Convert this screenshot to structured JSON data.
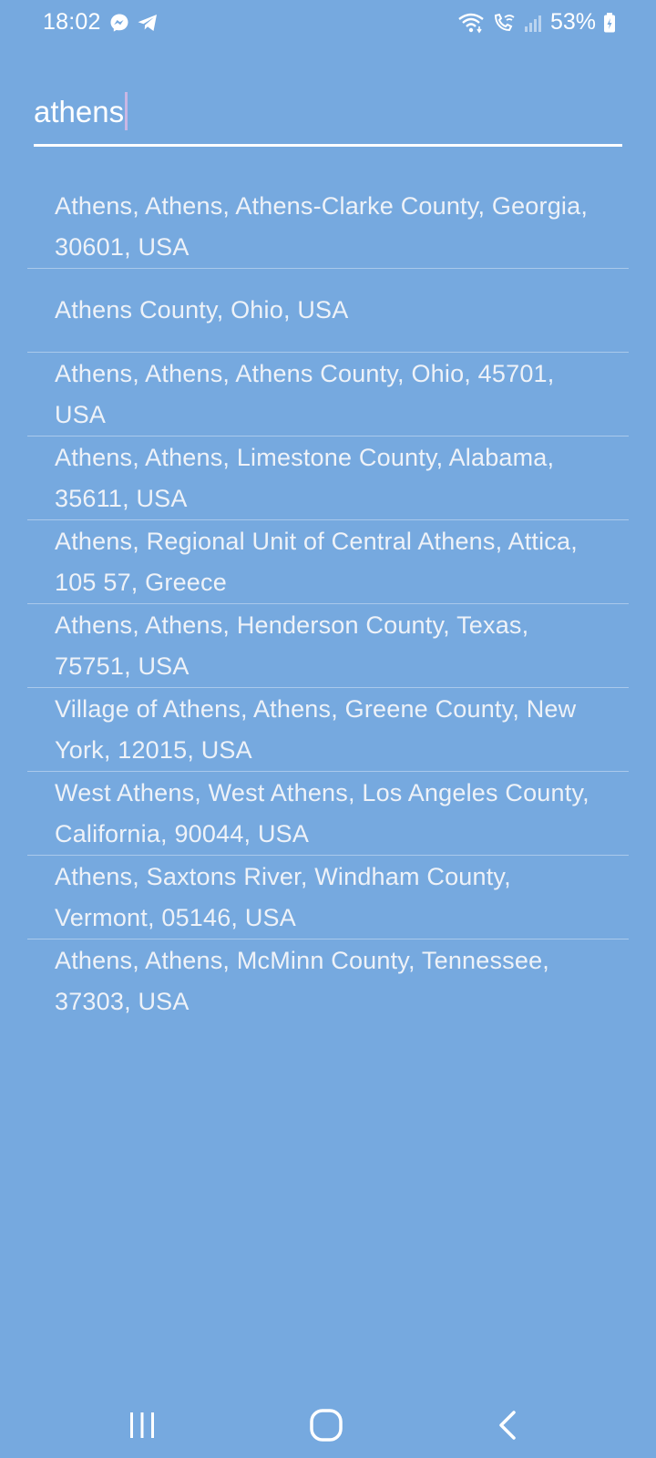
{
  "status_bar": {
    "time": "18:02",
    "battery_percent": "53%",
    "left_icons": [
      "messenger-icon",
      "telegram-icon"
    ],
    "right_icons": [
      "wifi-icon",
      "wifi-calling-icon",
      "signal-icon",
      "battery-icon"
    ]
  },
  "search": {
    "value": "athens"
  },
  "results": [
    {
      "label": "Athens, Athens, Athens-Clarke County, Georgia, 30601, USA"
    },
    {
      "label": "Athens County, Ohio, USA"
    },
    {
      "label": "Athens, Athens, Athens County, Ohio, 45701, USA"
    },
    {
      "label": "Athens, Athens, Limestone County, Alabama, 35611, USA"
    },
    {
      "label": "Athens, Regional Unit of Central Athens, Attica, 105 57, Greece"
    },
    {
      "label": "Athens, Athens, Henderson County, Texas, 75751, USA"
    },
    {
      "label": "Village of Athens, Athens, Greene County, New York, 12015, USA"
    },
    {
      "label": "West Athens, West Athens, Los Angeles County, California, 90044, USA"
    },
    {
      "label": "Athens, Saxtons River, Windham County, Vermont, 05146, USA"
    },
    {
      "label": "Athens, Athens, McMinn County, Tennessee, 37303, USA"
    }
  ],
  "nav_bar": {
    "icons": [
      "recents-icon",
      "home-icon",
      "back-icon"
    ]
  },
  "colors": {
    "background": "#76a9df",
    "text": "#ffffff",
    "result_text": "#eef2f8",
    "caret": "#c9b6e4"
  }
}
